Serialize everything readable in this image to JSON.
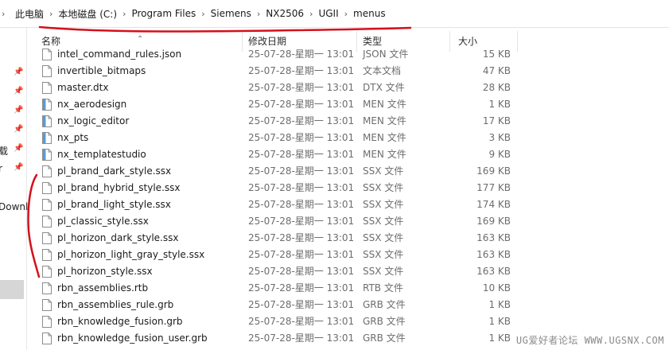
{
  "address": {
    "crumbs": [
      "此电脑",
      "本地磁盘 (C:)",
      "Program Files",
      "Siemens",
      "NX2506",
      "UGII",
      "menus"
    ]
  },
  "nav": {
    "fragments": [
      "载",
      "r",
      "Downl"
    ]
  },
  "columns": {
    "name": "名称",
    "date": "修改日期",
    "type": "类型",
    "size": "大小"
  },
  "files": [
    {
      "name": "intel_command_rules.json",
      "date": "25-07-28-星期一 13:01",
      "type": "JSON 文件",
      "size": "15 KB",
      "icon": "file-icon"
    },
    {
      "name": "invertible_bitmaps",
      "date": "25-07-28-星期一 13:01",
      "type": "文本文档",
      "size": "47 KB",
      "icon": "file-icon"
    },
    {
      "name": "master.dtx",
      "date": "25-07-28-星期一 13:01",
      "type": "DTX 文件",
      "size": "28 KB",
      "icon": "file-icon"
    },
    {
      "name": "nx_aerodesign",
      "date": "25-07-28-星期一 13:01",
      "type": "MEN 文件",
      "size": "1 KB",
      "icon": "men-icon"
    },
    {
      "name": "nx_logic_editor",
      "date": "25-07-28-星期一 13:01",
      "type": "MEN 文件",
      "size": "17 KB",
      "icon": "men-icon"
    },
    {
      "name": "nx_pts",
      "date": "25-07-28-星期一 13:01",
      "type": "MEN 文件",
      "size": "3 KB",
      "icon": "men-icon"
    },
    {
      "name": "nx_templatestudio",
      "date": "25-07-28-星期一 13:01",
      "type": "MEN 文件",
      "size": "9 KB",
      "icon": "men-icon"
    },
    {
      "name": "pl_brand_dark_style.ssx",
      "date": "25-07-28-星期一 13:01",
      "type": "SSX 文件",
      "size": "169 KB",
      "icon": "file-icon"
    },
    {
      "name": "pl_brand_hybrid_style.ssx",
      "date": "25-07-28-星期一 13:01",
      "type": "SSX 文件",
      "size": "177 KB",
      "icon": "file-icon"
    },
    {
      "name": "pl_brand_light_style.ssx",
      "date": "25-07-28-星期一 13:01",
      "type": "SSX 文件",
      "size": "174 KB",
      "icon": "file-icon"
    },
    {
      "name": "pl_classic_style.ssx",
      "date": "25-07-28-星期一 13:01",
      "type": "SSX 文件",
      "size": "169 KB",
      "icon": "file-icon"
    },
    {
      "name": "pl_horizon_dark_style.ssx",
      "date": "25-07-28-星期一 13:01",
      "type": "SSX 文件",
      "size": "163 KB",
      "icon": "file-icon"
    },
    {
      "name": "pl_horizon_light_gray_style.ssx",
      "date": "25-07-28-星期一 13:01",
      "type": "SSX 文件",
      "size": "163 KB",
      "icon": "file-icon"
    },
    {
      "name": "pl_horizon_style.ssx",
      "date": "25-07-28-星期一 13:01",
      "type": "SSX 文件",
      "size": "163 KB",
      "icon": "file-icon"
    },
    {
      "name": "rbn_assemblies.rtb",
      "date": "25-07-28-星期一 13:01",
      "type": "RTB 文件",
      "size": "10 KB",
      "icon": "file-icon"
    },
    {
      "name": "rbn_assemblies_rule.grb",
      "date": "25-07-28-星期一 13:01",
      "type": "GRB 文件",
      "size": "1 KB",
      "icon": "file-icon"
    },
    {
      "name": "rbn_knowledge_fusion.grb",
      "date": "25-07-28-星期一 13:01",
      "type": "GRB 文件",
      "size": "1 KB",
      "icon": "file-icon"
    },
    {
      "name": "rbn_knowledge_fusion_user.grb",
      "date": "25-07-28-星期一 13:01",
      "type": "GRB 文件",
      "size": "1 KB",
      "icon": "file-icon"
    }
  ],
  "watermark": "UG爱好者论坛 WWW.UGSNX.COM",
  "colors": {
    "annotation": "#d4101c",
    "selection": "#d6d6d6",
    "pin": "#4a6fa5"
  }
}
